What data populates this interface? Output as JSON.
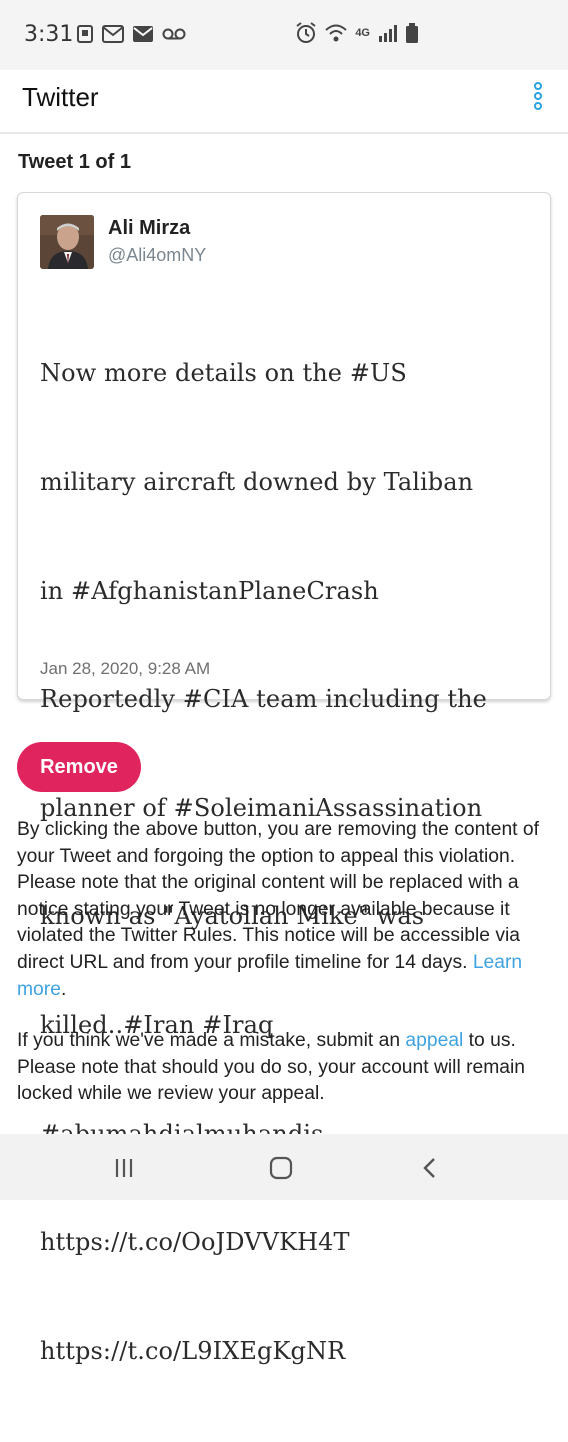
{
  "status_bar": {
    "time": "3:31",
    "left_icons": [
      "storage-icon",
      "mail-icon",
      "mail-icon",
      "voicemail-icon"
    ],
    "right_icons": [
      "alarm-icon",
      "wifi-icon",
      "lte-icon",
      "signal-icon",
      "battery-icon"
    ],
    "network_label": "4G"
  },
  "header": {
    "title": "Twitter",
    "menu_icon": "more-vertical-icon",
    "accent_color": "#29a4e3"
  },
  "tweet_count": "Tweet 1 of 1",
  "tweet": {
    "author_name": "Ali Mirza",
    "author_handle": "@Ali4omNY",
    "lines": [
      "Now more details on the #US",
      "military aircraft downed by Taliban",
      "in #AfghanistanPlaneCrash",
      "Reportedly #CIA team including the",
      "planner of #SoleimaniAssassination",
      "known as \"Ayatollah Mike\" was",
      "killed..#Iran #Iraq",
      "#abumahdialmuhandis",
      "https://t.co/OoJDVVKH4T",
      "https://t.co/L9IXEgKgNR"
    ],
    "date": "Jan 28, 2020, 9:28 AM"
  },
  "remove_button": {
    "label": "Remove",
    "color": "#e0245e"
  },
  "notice": {
    "text": "By clicking the above button, you are removing the content of your Tweet and forgoing the option to appeal this violation. Please note that the original content will be replaced with a notice stating your Tweet is no longer available because it violated the Twitter Rules. This notice will be accessible via direct URL and from your profile timeline for 14 days. ",
    "link": "Learn more",
    "tail": "."
  },
  "appeal": {
    "text_before": "If you think we've made a mistake, submit an ",
    "link": "appeal",
    "text_after": " to us. Please note that should you do so, your account will remain locked while we review your appeal."
  },
  "nav_bar": {
    "buttons": [
      "recent-apps-icon",
      "home-icon",
      "back-icon"
    ]
  }
}
